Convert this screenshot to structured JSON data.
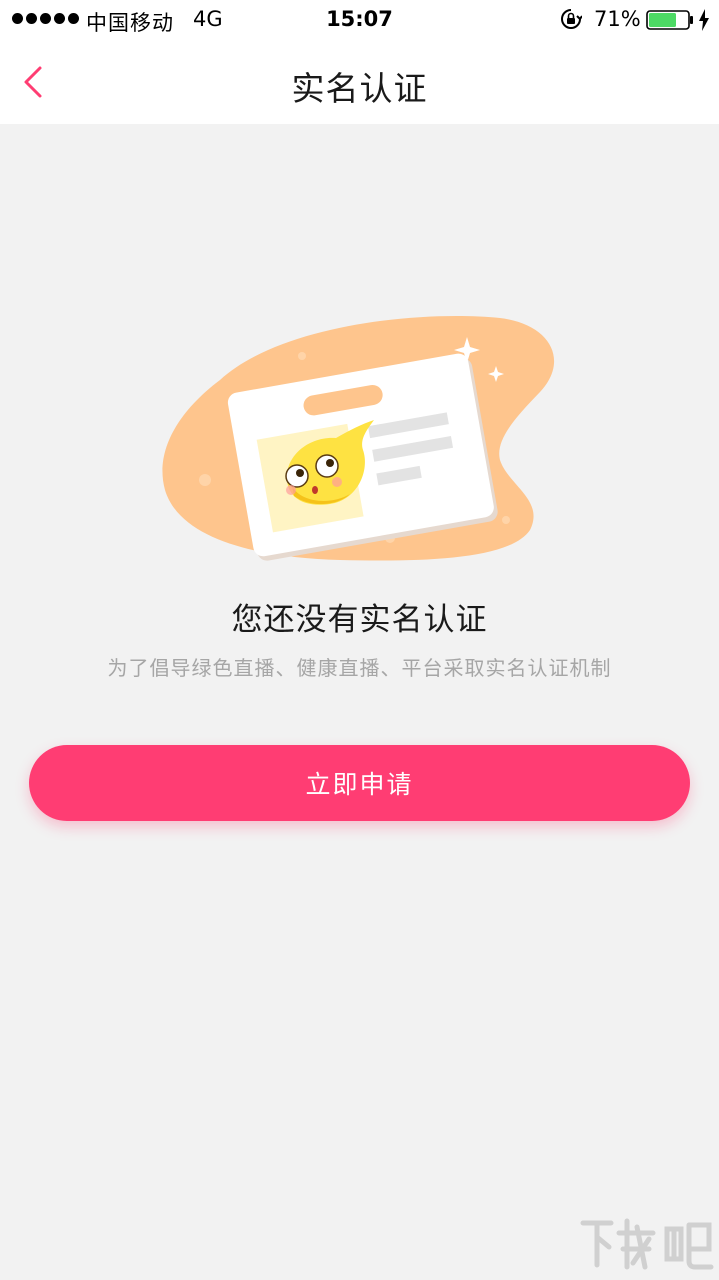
{
  "status_bar": {
    "carrier": "中国移动",
    "network": "4G",
    "time": "15:07",
    "battery_percent": "71%",
    "battery_level": 0.71,
    "battery_color": "#4cd964"
  },
  "nav": {
    "title": "实名认证",
    "back_icon": "chevron-left-icon",
    "accent_color": "#ff3d73"
  },
  "empty_state": {
    "illustration": "id-card-with-mascot",
    "title": "您还没有实名认证",
    "description": "为了倡导绿色直播、健康直播、平台采取实名认证机制"
  },
  "actions": {
    "apply_label": "立即申请",
    "apply_color": "#ff3d73"
  },
  "watermark": {
    "text": "下载吧"
  }
}
